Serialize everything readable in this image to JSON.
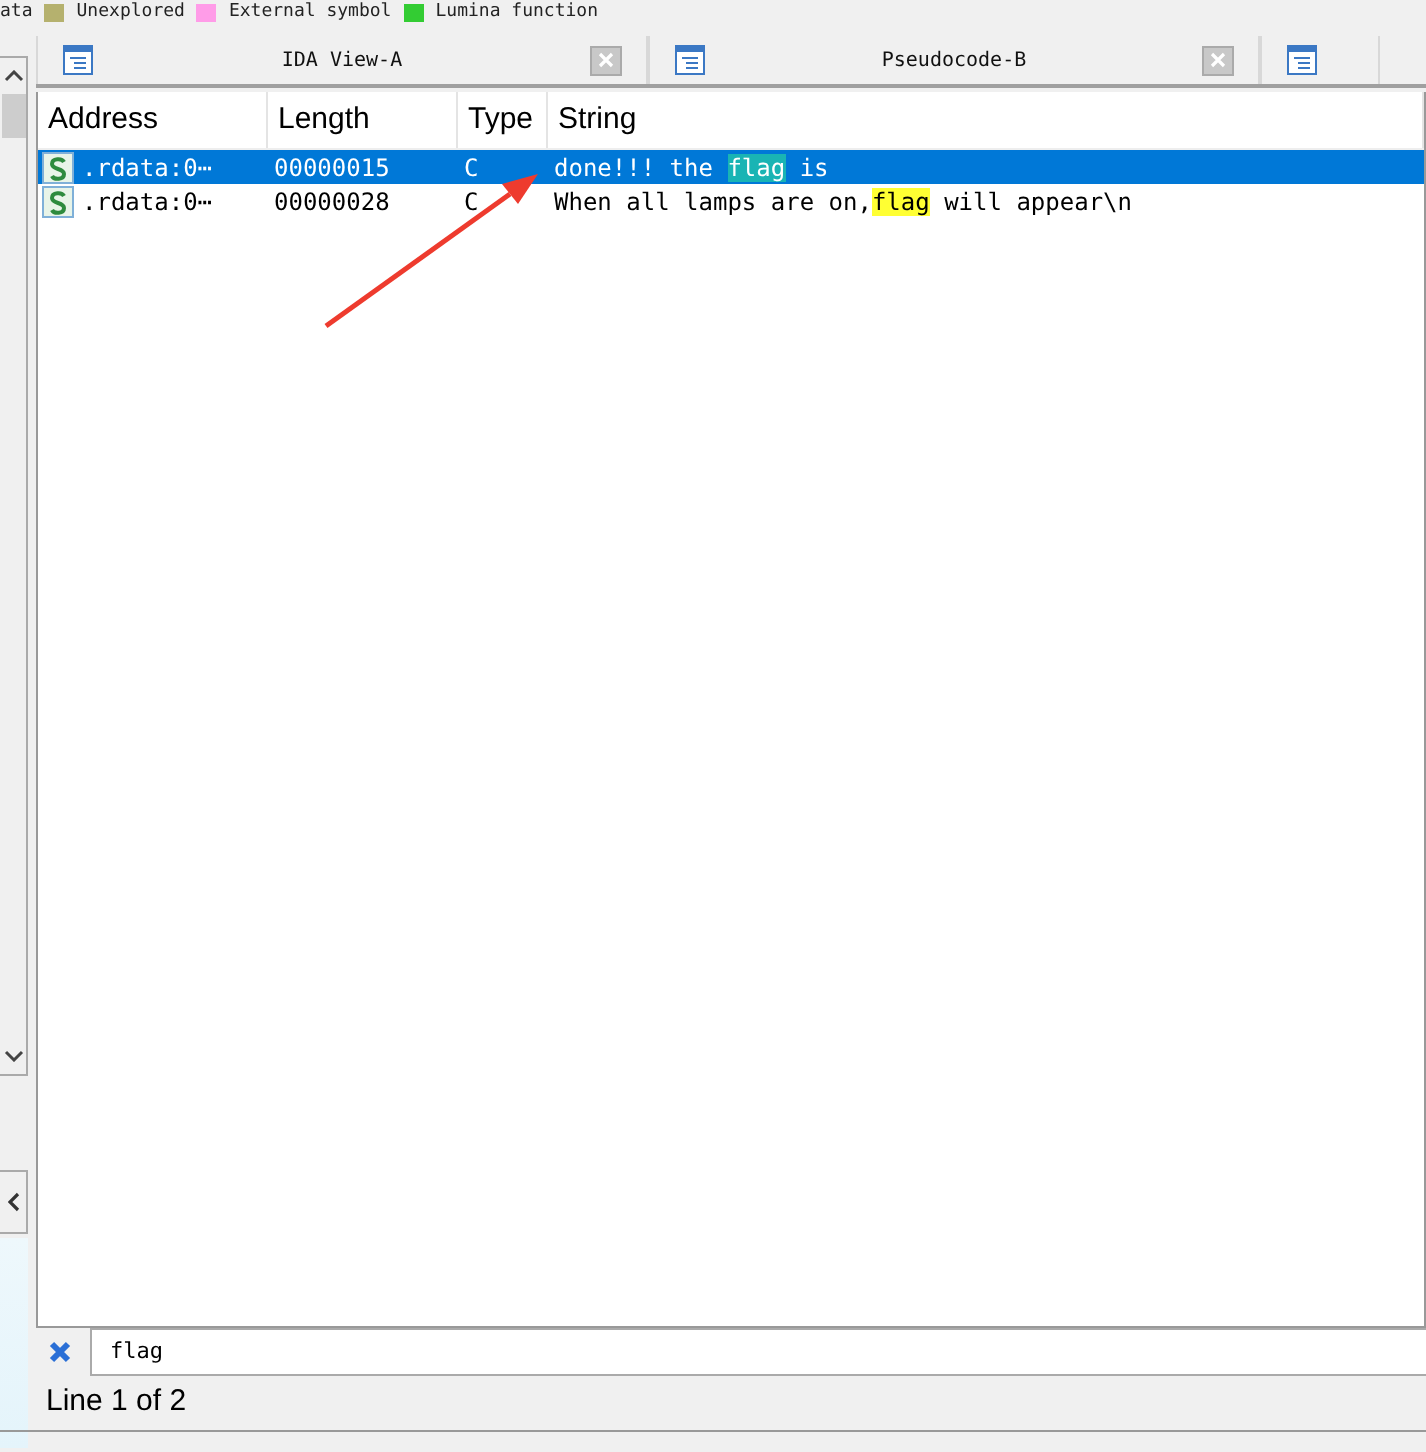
{
  "legend": [
    {
      "label": "ata"
    },
    {
      "label": "Unexplored",
      "color": "#b5b16e"
    },
    {
      "label": "External symbol",
      "color": "#ff9ce8"
    },
    {
      "label": "Lumina function",
      "color": "#33cc33"
    }
  ],
  "tabs": [
    {
      "label": "IDA View-A",
      "closable": true,
      "selected": false
    },
    {
      "label": "Pseudocode-B",
      "closable": true,
      "selected": false
    },
    {
      "closable": false,
      "selected": false
    }
  ],
  "table": {
    "columns": [
      "Address",
      "Length",
      "Type",
      "String"
    ],
    "rows": [
      {
        "selected": true,
        "address": ".rdata:0⋯",
        "length": "00000015",
        "type": "C",
        "string": [
          {
            "text": "done!!! the ",
            "highlight": false
          },
          {
            "text": "flag",
            "highlight": true
          },
          {
            "text": " is",
            "highlight": false
          }
        ]
      },
      {
        "selected": false,
        "address": ".rdata:0⋯",
        "length": "00000028",
        "type": "C",
        "string": [
          {
            "text": "When all lamps are on,",
            "highlight": false
          },
          {
            "text": "flag",
            "highlight": true
          },
          {
            "text": " will appear\\n",
            "highlight": false
          }
        ]
      }
    ]
  },
  "annotation": {
    "kind": "arrow"
  },
  "search": {
    "value": "flag"
  },
  "status_bar": "Line 1 of 2"
}
